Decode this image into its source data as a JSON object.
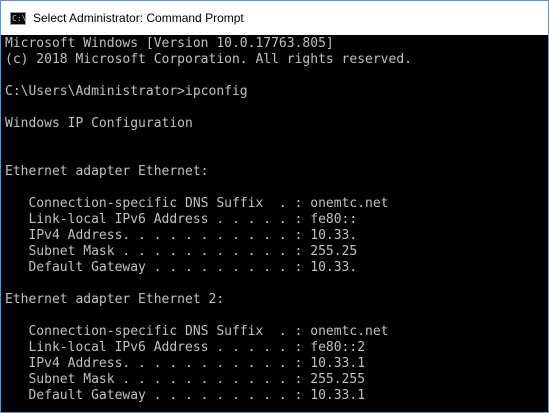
{
  "window": {
    "title": "Select Administrator: Command Prompt",
    "icon_glyph": "C:\\"
  },
  "console": {
    "lines": [
      "Microsoft Windows [Version 10.0.17763.805]",
      "(c) 2018 Microsoft Corporation. All rights reserved.",
      "",
      "C:\\Users\\Administrator>ipconfig",
      "",
      "Windows IP Configuration",
      "",
      "",
      "Ethernet adapter Ethernet:",
      "",
      "   Connection-specific DNS Suffix  . : onemtc.net",
      "   Link-local IPv6 Address . . . . . : fe80::",
      "   IPv4 Address. . . . . . . . . . . : 10.33.",
      "   Subnet Mask . . . . . . . . . . . : 255.25",
      "   Default Gateway . . . . . . . . . : 10.33.",
      "",
      "Ethernet adapter Ethernet 2:",
      "",
      "   Connection-specific DNS Suffix  . : onemtc.net",
      "   Link-local IPv6 Address . . . . . : fe80::2",
      "   IPv4 Address. . . . . . . . . . . : 10.33.1",
      "   Subnet Mask . . . . . . . . . . . : 255.255",
      "   Default Gateway . . . . . . . . . : 10.33.1"
    ]
  }
}
